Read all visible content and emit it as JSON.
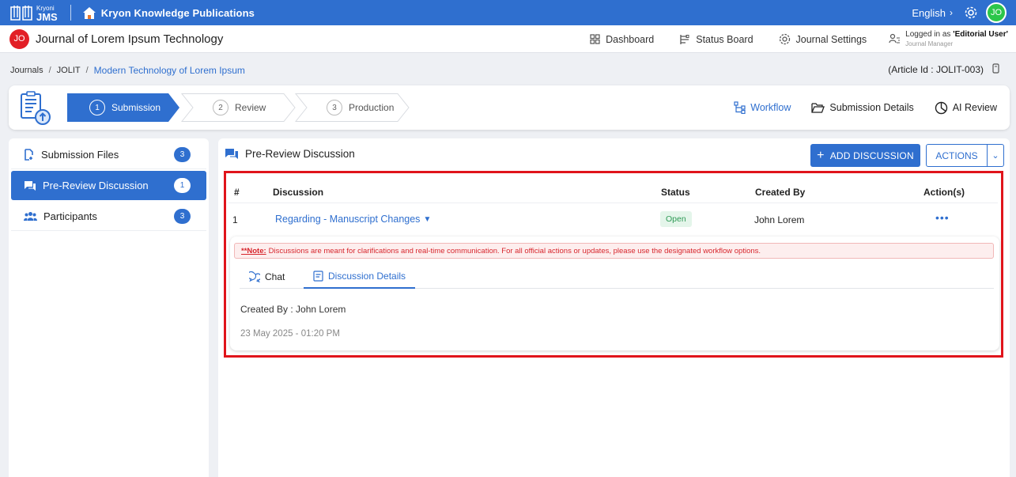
{
  "app": {
    "logo_small": "Kryoni",
    "logo_big": "JMS",
    "publisher": "Kryon Knowledge Publications",
    "language": "English",
    "user_initials": "JO"
  },
  "journal": {
    "initials": "JO",
    "title": "Journal of Lorem Ipsum Technology",
    "nav": {
      "dashboard": "Dashboard",
      "status_board": "Status Board",
      "journal_settings": "Journal Settings"
    },
    "login_prefix": "Logged in as ",
    "login_user": "'Editorial User'",
    "login_role": "Journal Manager"
  },
  "breadcrumb": {
    "items": [
      "Journals",
      "JOLIT"
    ],
    "current": "Modern Technology of Lorem Ipsum",
    "separator": "/"
  },
  "article_id": "(Article Id : JOLIT-003)",
  "workflow": {
    "steps": [
      {
        "num": "1",
        "label": "Submission",
        "active": true
      },
      {
        "num": "2",
        "label": "Review",
        "active": false
      },
      {
        "num": "3",
        "label": "Production",
        "active": false
      }
    ],
    "actions": {
      "workflow": "Workflow",
      "submission_details": "Submission Details",
      "ai_review": "AI Review"
    }
  },
  "sidebar": {
    "items": [
      {
        "label": "Submission Files",
        "count": "3"
      },
      {
        "label": "Pre-Review Discussion",
        "count": "1"
      },
      {
        "label": "Participants",
        "count": "3"
      }
    ]
  },
  "main": {
    "title": "Pre-Review Discussion",
    "add_button": "ADD DISCUSSION",
    "actions_button": "ACTIONS",
    "table": {
      "headers": [
        "#",
        "Discussion",
        "Status",
        "Created By",
        "Action(s)"
      ],
      "rows": [
        {
          "num": "1",
          "discussion": "Regarding - Manuscript Changes",
          "status": "Open",
          "created_by": "John Lorem",
          "action": "•••"
        }
      ]
    },
    "detail": {
      "note_label": "**Note:",
      "note_text": "Discussions are meant for clarifications and real-time communication. For all official actions or updates, please use the designated workflow options.",
      "tabs": [
        "Chat",
        "Discussion Details"
      ],
      "created_by": "Created By : John Lorem",
      "created_at": "23 May 2025 - 01:20 PM"
    }
  },
  "colors": {
    "primary": "#2f6fcf",
    "highlight": "#e0141b",
    "status_open": "#2e9a55"
  }
}
